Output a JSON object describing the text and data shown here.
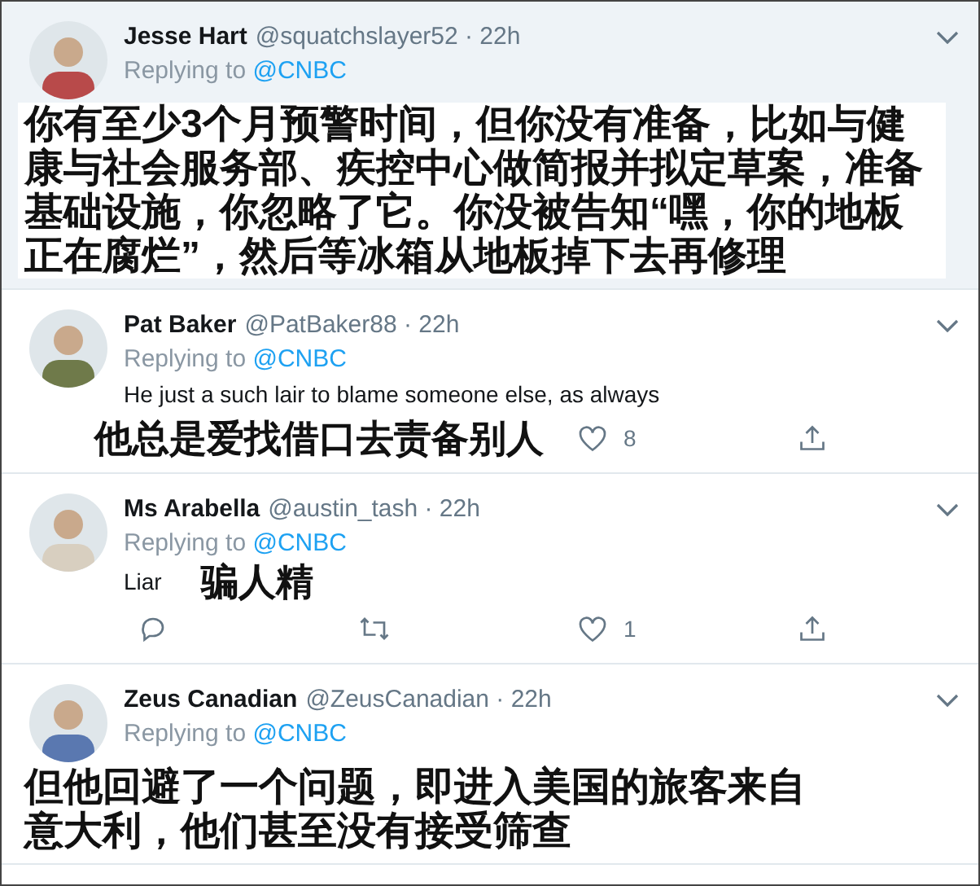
{
  "tweets": [
    {
      "name": "Jesse Hart",
      "byline": "@squatchslayer52 · 22h",
      "replying_label": "Replying to",
      "replying_handle": "@CNBC",
      "highlighted": true,
      "subtitle": {
        "kind": "block",
        "lines": [
          "你有至少3个月预警时间，但你没有准备，比如与健",
          "康与社会服务部、疾控中心做简报并拟定草案，准备",
          "基础设施，你忽略了它。你没被告知“嘿，你的地板",
          "正在腐烂”，然后等冰箱从地板掉下去再修理"
        ]
      }
    },
    {
      "name": "Pat Baker",
      "byline": "@PatBaker88 · 22h",
      "replying_label": "Replying to",
      "replying_handle": "@CNBC",
      "highlighted": false,
      "text": "He just a such lair to blame someone else, as always",
      "subtitle": {
        "kind": "footer",
        "lines": [
          "他总是爱找借口去责备别人"
        ]
      },
      "actions": [
        {
          "kind": "like",
          "count": "8"
        },
        {
          "kind": "share"
        }
      ]
    },
    {
      "name": "Ms Arabella",
      "byline": "@austin_tash · 22h",
      "replying_label": "Replying to",
      "replying_handle": "@CNBC",
      "highlighted": false,
      "text": "Liar",
      "subtitle": {
        "kind": "inline",
        "lines": [
          "骗人精"
        ]
      },
      "actions": [
        {
          "kind": "reply"
        },
        {
          "kind": "retweet"
        },
        {
          "kind": "like",
          "count": "1"
        },
        {
          "kind": "share"
        }
      ]
    },
    {
      "name": "Zeus Canadian",
      "byline": "@ZeusCanadian · 22h",
      "replying_label": "Replying to",
      "replying_handle": "@CNBC",
      "highlighted": false,
      "subtitle": {
        "kind": "block",
        "lines": [
          "但他回避了一个问题，即进入美国的旅客来自",
          "意大利，他们甚至没有接受筛查"
        ]
      }
    }
  ]
}
